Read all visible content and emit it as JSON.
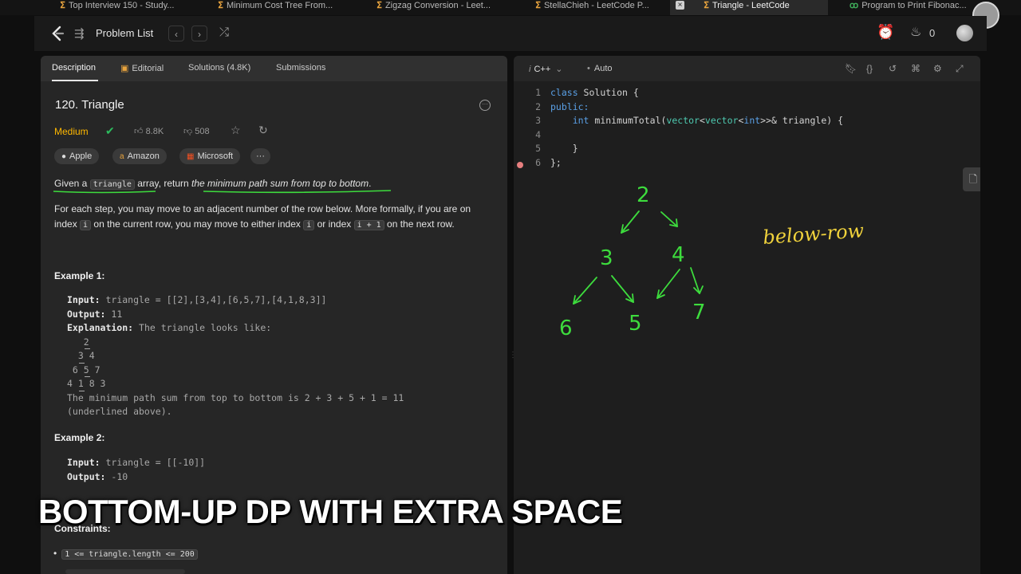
{
  "browser_tabs": [
    {
      "label": "Top Interview 150 - Study...",
      "favicon": "leetcode",
      "active": false
    },
    {
      "label": "Minimum Cost Tree From...",
      "favicon": "leetcode",
      "active": false
    },
    {
      "label": "Zigzag Conversion - Leet...",
      "favicon": "leetcode",
      "active": false
    },
    {
      "label": "StellaChieh - LeetCode P...",
      "favicon": "leetcode",
      "active": false
    },
    {
      "label": "Triangle - LeetCode",
      "favicon": "leetcode",
      "active": true
    },
    {
      "label": "Program to Print Fibonac...",
      "favicon": "geeksforgeeks",
      "active": false
    }
  ],
  "topnav": {
    "problem_list": "Problem List",
    "prev": "‹",
    "next": "›",
    "streak_count": "0"
  },
  "left_tabs": [
    "Description",
    "Editorial",
    "Solutions (4.8K)",
    "Submissions"
  ],
  "problem": {
    "title": "120. Triangle",
    "difficulty": "Medium",
    "likes": "8.8K",
    "dislikes": "508",
    "companies": [
      "Apple",
      "Amazon",
      "Microsoft"
    ],
    "more_companies": "···",
    "statement": {
      "p1_a": "Given a ",
      "p1_code": "triangle",
      "p1_b": " array, return ",
      "p1_c": "the minimum path sum from top to bottom",
      "p1_d": ".",
      "p2_a": "For each step, you may move to an adjacent number of the row below. More formally, if you are on",
      "p2_b": "index ",
      "p2_i": "i",
      "p2_c": " on the current row, you may move to either index ",
      "p2_i2": "i",
      "p2_d": " or index ",
      "p2_i3": "i + 1",
      "p2_e": " on the next row."
    },
    "example1": {
      "heading": "Example 1:",
      "input_label": "Input:",
      "input": " triangle = [[2],[3,4],[6,5,7],[4,1,8,3]]",
      "output_label": "Output:",
      "output": " 11",
      "explanation_label": "Explanation:",
      "explanation": " The triangle looks like:",
      "tri_rows": [
        "   2",
        "  3 4",
        " 6 5 7",
        "4 1 8 3"
      ],
      "summary_1": "The minimum path sum from top to bottom is 2 + 3 + 5 + 1 = 11",
      "summary_2": "(underlined above)."
    },
    "example2": {
      "heading": "Example 2:",
      "input_label": "Input:",
      "input": " triangle = [[-10]]",
      "output_label": "Output:",
      "output": " -10"
    },
    "constraints_heading": "Constraints:",
    "constraint_1": "1 <= triangle.length <= 200"
  },
  "editor": {
    "language": "C++",
    "mode": "Auto",
    "lines": [
      {
        "n": "1",
        "parts": [
          {
            "t": "class ",
            "c": "kw"
          },
          {
            "t": "Solution {",
            "c": ""
          }
        ]
      },
      {
        "n": "2",
        "parts": [
          {
            "t": "public:",
            "c": "kw"
          }
        ]
      },
      {
        "n": "3",
        "parts": [
          {
            "t": "    ",
            "c": ""
          },
          {
            "t": "int",
            "c": "kw"
          },
          {
            "t": " minimumTotal(",
            "c": ""
          },
          {
            "t": "vector",
            "c": "ty"
          },
          {
            "t": "<",
            "c": ""
          },
          {
            "t": "vector",
            "c": "ty"
          },
          {
            "t": "<",
            "c": ""
          },
          {
            "t": "int",
            "c": "kw"
          },
          {
            "t": ">>& triangle) {",
            "c": ""
          }
        ]
      },
      {
        "n": "4",
        "parts": [
          {
            "t": "",
            "c": ""
          }
        ]
      },
      {
        "n": "5",
        "parts": [
          {
            "t": "    }",
            "c": ""
          }
        ]
      },
      {
        "n": "6",
        "parts": [
          {
            "t": "};",
            "c": ""
          }
        ]
      }
    ]
  },
  "drawing": {
    "nodes": [
      "2",
      "3",
      "4",
      "6",
      "5",
      "7"
    ],
    "note": "below-row",
    "ink_color": "#3ddc3d",
    "note_color": "#f0d23c"
  },
  "banner": "BOTTOM-UP DP WITH EXTRA SPACE",
  "colors": {
    "medium": "#ffb800",
    "solved": "#2cbb5d"
  }
}
